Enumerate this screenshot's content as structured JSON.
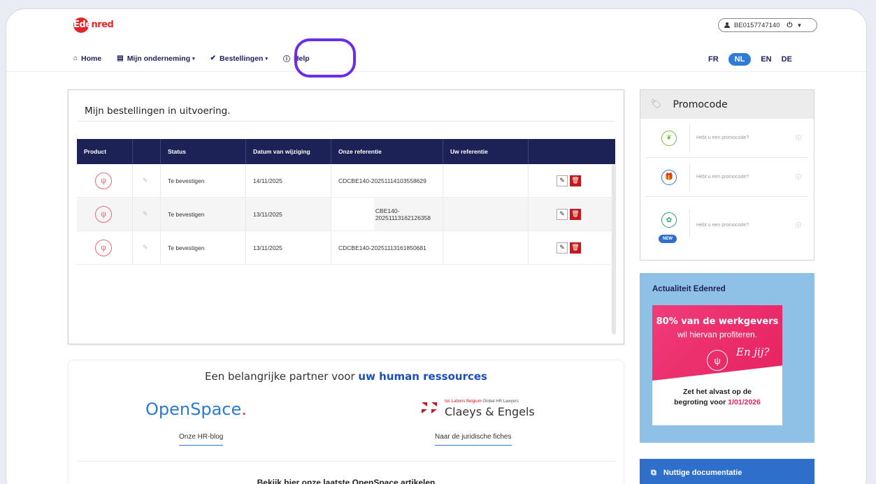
{
  "header": {
    "logo": "Edenred",
    "account_id": "BE0157747140",
    "nav": [
      {
        "label": "Home",
        "icon": "home-icon"
      },
      {
        "label": "Mijn onderneming",
        "icon": "building-icon",
        "dropdown": true
      },
      {
        "label": "Bestellingen",
        "icon": "check-circle-icon",
        "dropdown": true
      },
      {
        "label": "Help",
        "icon": "info-icon"
      }
    ],
    "languages": [
      "FR",
      "NL",
      "EN",
      "DE"
    ],
    "active_language": "NL"
  },
  "orders": {
    "title": "Mijn bestellingen in uitvoering.",
    "columns": [
      "Product",
      "",
      "Status",
      "Datum van wijziging",
      "Onze referentie",
      "Uw referentie",
      ""
    ],
    "rows": [
      {
        "status": "Te bevestigen",
        "date": "14/11/2025",
        "ref": "CDCBE140-20251114103558629",
        "own_ref": ""
      },
      {
        "status": "Te bevestigen",
        "date": "13/11/2025",
        "ref": "CBE140-20251113162126358",
        "own_ref": ""
      },
      {
        "status": "Te bevestigen",
        "date": "13/11/2025",
        "ref": "CDCBE140-20251113161850681",
        "own_ref": ""
      }
    ]
  },
  "partners": {
    "title_pre": "Een belangrijke partner voor ",
    "title_bold": "uw human ressources",
    "openspace_name": "OpenSpace",
    "openspace_dot": ".",
    "claeys_tagline_red": "Ius Laboris Belgium",
    "claeys_tagline_gray": "Global HR Lawyers",
    "claeys_name": "Claeys & Engels",
    "blog_link": "Onze HR-blog",
    "fiches_link": "Naar de juridische fiches",
    "footer": "Bekijk hier onze laatste OpenSpace artikelen"
  },
  "promo": {
    "title": "Promocode",
    "placeholder": "Hebt u een promocode?",
    "new_badge": "NEW",
    "colors": [
      "#7ab93a",
      "#2e7bd8",
      "#2aa06a"
    ]
  },
  "news": {
    "title": "Actualiteit Edenred",
    "line1": "80% van de werkgevers",
    "line2": "wil hiervan profiteren.",
    "script": "En jij?",
    "sub1": "Zet het alvast op de",
    "sub2": "begroting voor ",
    "date": "1/01/2026"
  },
  "docs": {
    "label": "Nuttige documentatie"
  }
}
